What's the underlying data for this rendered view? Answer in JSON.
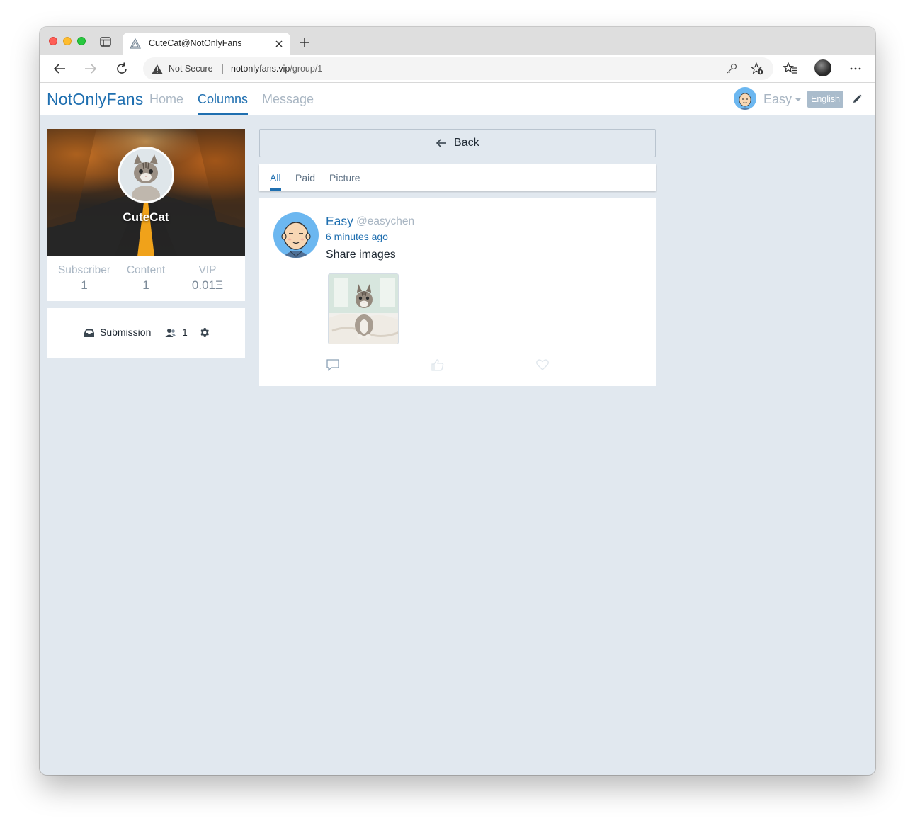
{
  "browser": {
    "tab_title": "CuteCat@NotOnlyFans",
    "security_label": "Not Secure",
    "url_host": "notonlyfans.vip",
    "url_path": "/group/1"
  },
  "nav": {
    "brand": "NotOnlyFans",
    "links": [
      {
        "label": "Home",
        "active": false
      },
      {
        "label": "Columns",
        "active": true
      },
      {
        "label": "Message",
        "active": false
      }
    ],
    "user_name": "Easy",
    "language_button": "English"
  },
  "group": {
    "name": "CuteCat",
    "stats": [
      {
        "label": "Subscriber",
        "value": "1"
      },
      {
        "label": "Content",
        "value": "1"
      },
      {
        "label": "VIP",
        "value": "0.01Ξ"
      }
    ],
    "submission_label": "Submission",
    "member_count": "1"
  },
  "feed": {
    "back_label": "Back",
    "filters": [
      {
        "label": "All",
        "active": true
      },
      {
        "label": "Paid",
        "active": false
      },
      {
        "label": "Picture",
        "active": false
      }
    ],
    "post": {
      "author": "Easy",
      "handle": "@easychen",
      "time": "6 minutes ago",
      "text": "Share images"
    }
  },
  "colors": {
    "brand": "#1f6fb0",
    "page_bg": "#e1e8ef",
    "muted": "#a9b6c3"
  }
}
